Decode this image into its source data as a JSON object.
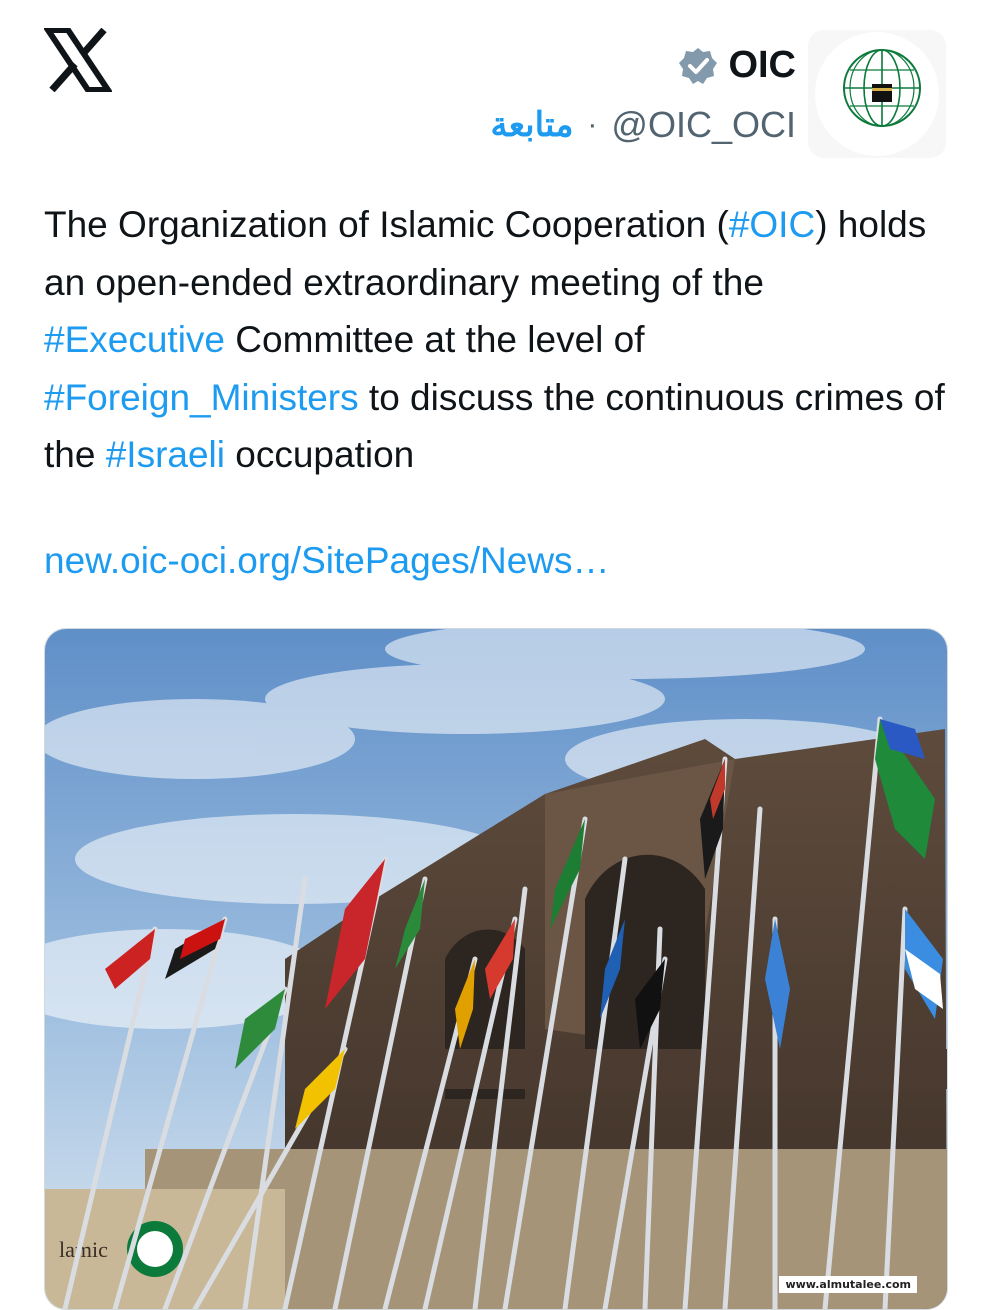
{
  "account": {
    "name": "OIC",
    "handle": "@OIC_OCI",
    "separator": "·",
    "follow_label": "متابعة"
  },
  "tweet": {
    "parts": [
      {
        "text": "The Organization of Islamic Cooperation (",
        "hashtag": false
      },
      {
        "text": "#OIC",
        "hashtag": true
      },
      {
        "text": ") holds an open-ended extraordinary meeting of the ",
        "hashtag": false
      },
      {
        "text": "#Executive",
        "hashtag": true
      },
      {
        "text": " Committee at the level of ",
        "hashtag": false
      },
      {
        "text": "#Foreign_Ministers",
        "hashtag": true
      },
      {
        "text": " to discuss the continuous crimes of the ",
        "hashtag": false
      },
      {
        "text": "#Israeli",
        "hashtag": true
      },
      {
        "text": " occupation",
        "hashtag": false
      }
    ],
    "link": "new.oic-oci.org/SitePages/News…"
  },
  "media": {
    "sign_text": "lamic",
    "watermark": "www.almutalee.com"
  },
  "colors": {
    "accent": "#1d9bf0",
    "text": "#0f1419",
    "secondary": "#536471",
    "oic_green": "#0b7a3b"
  },
  "icons": [
    "x-logo-icon",
    "verified-badge-icon",
    "oic-emblem-icon"
  ]
}
